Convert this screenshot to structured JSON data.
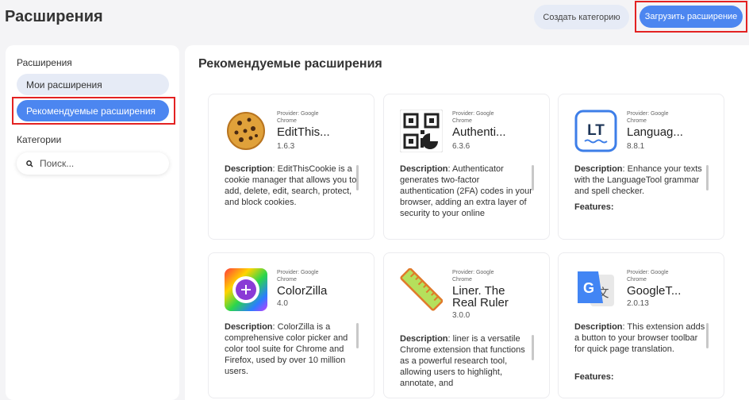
{
  "header": {
    "title": "Расширения",
    "create_category": "Создать категорию",
    "upload_extension": "Загрузить расширение"
  },
  "sidebar": {
    "extensions_heading": "Расширения",
    "my_extensions": "Мои расширения",
    "recommended": "Рекомендуемые расширения",
    "categories_heading": "Категории",
    "search_placeholder": "Поиск..."
  },
  "main": {
    "title": "Рекомендуемые расширения",
    "cards": [
      {
        "provider": "Provider: Google Chrome",
        "name": "EditThis...",
        "version": "1.6.3",
        "desc_label": "Description",
        "description": ": EditThisCookie is a cookie manager that allows you to add, delete, edit, search, protect, and block cookies.",
        "icon": "cookie-icon"
      },
      {
        "provider": "Provider: Google Chrome",
        "name": "Authenti...",
        "version": "6.3.6",
        "desc_label": "Description",
        "description": ": Authenticator generates two-factor authentication (2FA) codes in your browser, adding an extra layer of security to your online",
        "icon": "qr-code-icon"
      },
      {
        "provider": "Provider: Google Chrome",
        "name": "Languag...",
        "version": "8.8.1",
        "desc_label": "Description",
        "description": ": Enhance your texts with the LanguageTool grammar and spell checker.",
        "features": "Features:",
        "icon": "languagetool-icon"
      },
      {
        "provider": "Provider: Google Chrome",
        "name": "ColorZilla",
        "version": "4.0",
        "desc_label": "Description",
        "description": ": ColorZilla is a comprehensive color picker and color tool suite for Chrome and Firefox, used by over 10 million users.",
        "icon": "color-wheel-icon"
      },
      {
        "provider": "Provider: Google Chrome",
        "name": "Liner. The Real Ruler",
        "version": "3.0.0",
        "desc_label": "Description",
        "description": ": liner is a versatile Chrome extension that functions as a powerful research tool, allowing users to highlight, annotate, and",
        "icon": "ruler-icon"
      },
      {
        "provider": "Provider: Google Chrome",
        "name": "GoogleT...",
        "version": "2.0.13",
        "desc_label": "Description",
        "description": ": This extension adds a button to your browser toolbar for quick page translation.",
        "features": "Features:",
        "icon": "google-translate-icon"
      }
    ]
  },
  "colors": {
    "accent": "#4c86f0",
    "accent_light": "#e6ebf6",
    "highlight_border": "#e32222"
  }
}
